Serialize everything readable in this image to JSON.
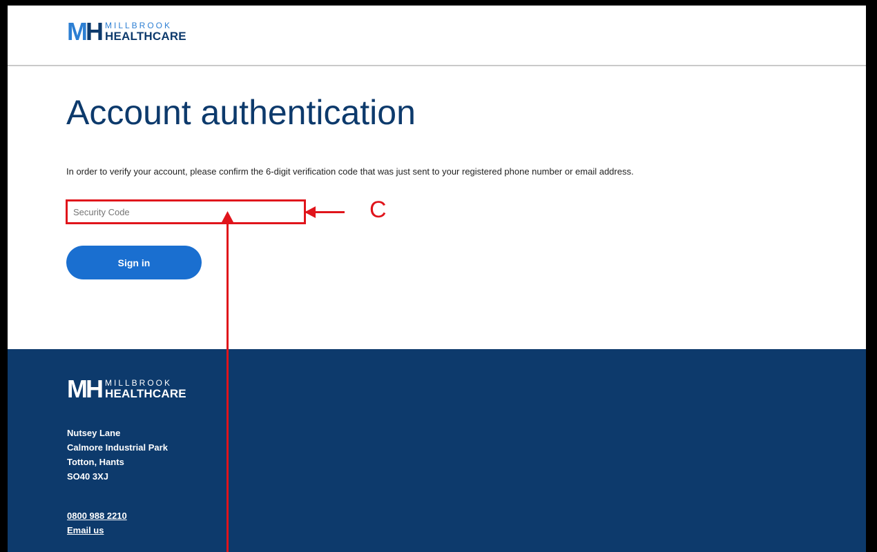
{
  "brand": {
    "mark_left": "M",
    "mark_right": "H",
    "word_top": "MILLBROOK",
    "word_bottom": "HEALTHCARE",
    "colors": {
      "brand_light_blue": "#2d7fd3",
      "brand_navy": "#0d3a6c",
      "button_blue": "#1a6fd0",
      "annotation_red": "#e0141b"
    }
  },
  "main": {
    "title": "Account authentication",
    "instructions": "In order to verify your account, please confirm the 6-digit verification code that was just sent to your registered phone number or email address.",
    "security_code": {
      "value": "",
      "placeholder": "Security Code"
    },
    "sign_in_label": "Sign in"
  },
  "footer": {
    "address": [
      "Nutsey Lane",
      "Calmore Industrial Park",
      "Totton, Hants",
      "SO40 3XJ"
    ],
    "phone": "0800 988 2210",
    "email_label": "Email us"
  },
  "annotation": {
    "label": "C"
  }
}
